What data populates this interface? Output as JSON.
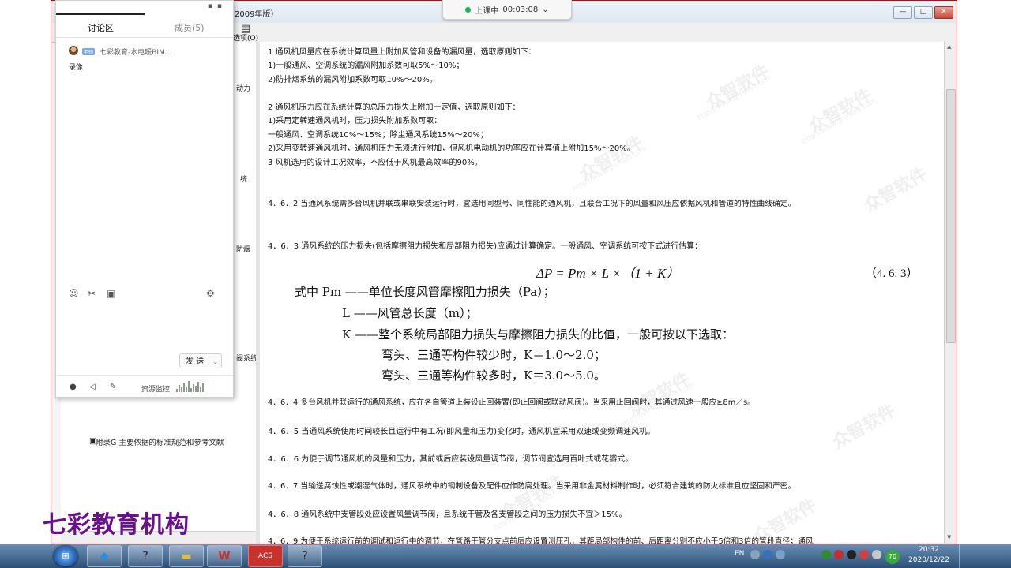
{
  "window": {
    "title_fragment": "2009年版）",
    "toolbar_label": "选项(O)",
    "controls": {
      "minimize": "—",
      "maximize": "□",
      "close": "✕"
    }
  },
  "timer": {
    "status": "上课中",
    "time": "00:03:08",
    "caret": "⌄"
  },
  "chat": {
    "tabs": {
      "discussion": "讨论区",
      "members": "成员(5)"
    },
    "message": {
      "tag": "老师",
      "user": "七彩教育-水电暖BIM...",
      "text": "录像"
    },
    "send_label": "发 送",
    "send_caret": "⌄",
    "resource_monitor": "资源监控"
  },
  "left_tree": {
    "fragments": [
      "动力",
      "统",
      "防烟",
      "",
      "阀系统"
    ],
    "last_item": "附录G  主要依据的标准规范和参考文献"
  },
  "document": {
    "lines": [
      "1  通风机风量应在系统计算风量上附加风管和设备的漏风量，选取原则如下：",
      "1)一般通风、空调系统的漏风附加系数可取5%～10%；",
      "2)防排烟系统的漏风附加系数可取10%～20%。",
      "2  通风机压力应在系统计算的总压力损失上附加一定值，选取原则如下：",
      "1)采用定转速通风机时，压力损失附加系数可取：",
      "一般通风、空调系统10%～15%；除尘通风系统15%～20%；",
      "2)采用变转速通风机时，通风机压力无须进行附加，但风机电动机的功率应在计算值上附加15%～20%。",
      "3  风机选用的设计工况效率，不应低于风机最高效率的90%。",
      "4．6．2  当通风系统需多台风机并联或串联安装运行时，宜选用同型号、同性能的通风机，且联合工况下的风量和风压应依据风机和管道的特性曲线确定。",
      "4．6．3  通风系统的压力损失(包括摩擦阻力损失和局部阻力损失)应通过计算确定。一般通风、空调系统可按下式进行估算：",
      "4．6．4  多台风机并联运行的通风系统，应在各自管道上装设止回装置(即止回阀或联动风阀)。当采用止回阀时，其通过风速一般应≥8m／s。",
      "4．6．5  当通风系统使用时间较长且运行中有工况(即风量和压力)变化时，通风机宜采用双速或变频调速风机。",
      "4．6．6  为便于调节通风机的风量和压力，其前或后应装设风量调节阀，调节阀宜选用百叶式或花瓣式。",
      "4．6．7  当输送腐蚀性或潮湿气体时，通风系统中的钢制设备及配件应作防腐处理。当采用非金属材料制作时，必须符合建筑的防火标准且应坚固和严密。",
      "4．6．8  通风系统中支管段处应设置风量调节阀，且系统干管及各支管段之间的压力损失不宜＞15%。",
      "4．6．9  为便于系统运行前的调试和运行中的调节，在管路干管分支点前后应设置测压孔，其距局部构件的前、后距离分别不应小于5倍和3倍的管段直径；通风"
    ],
    "formula": "ΔP = Pm × L ×（1 + K）",
    "formula_number": "（4. 6. 3）",
    "formula_lines": [
      "式中  Pm ——单位长度风管摩擦阻力损失（Pa）；",
      "L ——风管总长度（m）；",
      "K ——整个系统局部阻力损失与摩擦阻力损失的比值，一般可按以下选取：",
      "弯头、三通等构件较少时，K＝1.0～2.0；",
      "弯头、三通等构件较多时，K＝3.0～5.0。"
    ],
    "watermark": "众智软件",
    "watermark_url": "http://www.gisroad.com"
  },
  "brand": "七彩教育机构",
  "taskbar": {
    "apps": [
      "",
      "?",
      "",
      "W",
      "ACS",
      "?"
    ],
    "tray_lang": "EN",
    "badge": "70",
    "time": "20:32",
    "date": "2020/12/22"
  },
  "colors": {
    "frame_border": "#d00000",
    "brand": "#6a0f8e",
    "timer_dot": "#18b84a"
  }
}
